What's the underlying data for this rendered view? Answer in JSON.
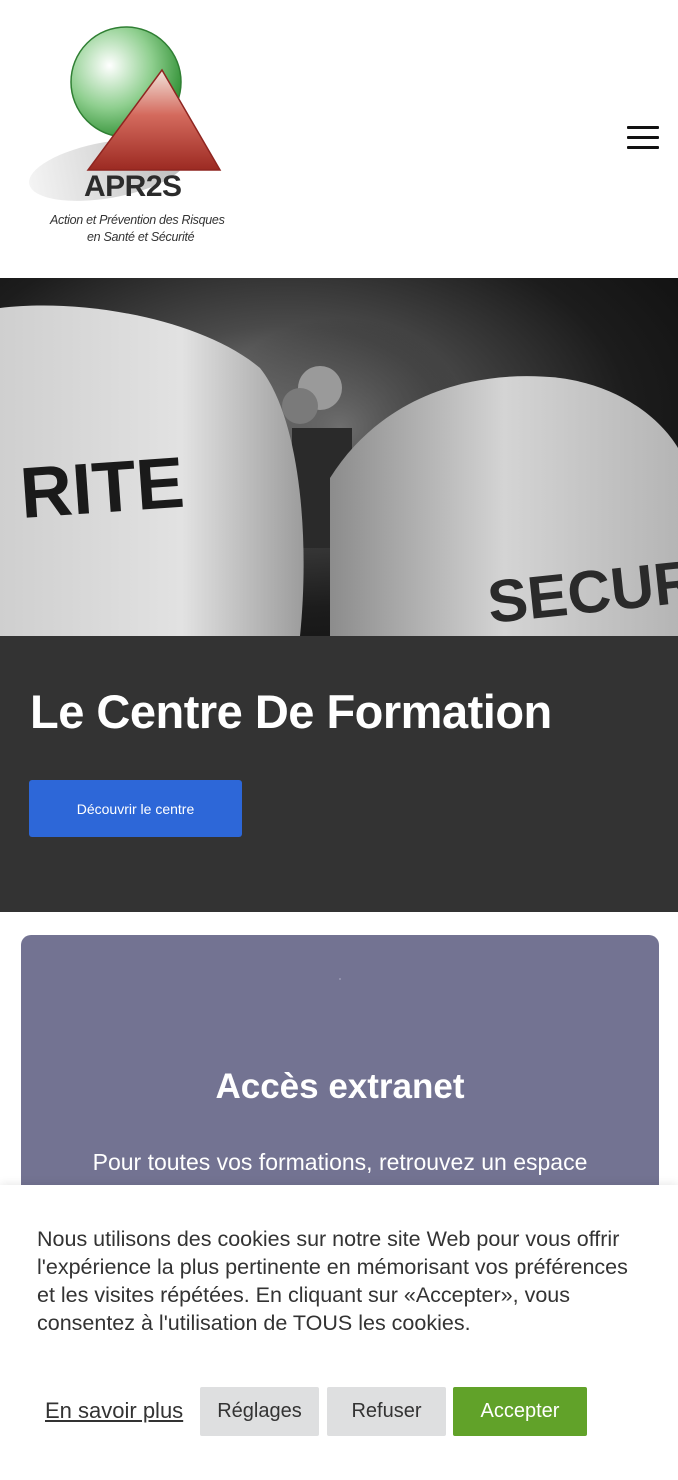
{
  "header": {
    "logo": {
      "name": "APR2S",
      "tagline_line1": "Action et Prévention des Risques",
      "tagline_line2": "en Santé et Sécurité",
      "colors": {
        "circle": "#3d9a3d",
        "triangle": "#b7302a"
      }
    },
    "menu_icon": "hamburger-menu-icon"
  },
  "hero": {
    "image": "security-staff-photo",
    "image_texts": {
      "left": "RITE",
      "right": "SECURIT"
    }
  },
  "formation": {
    "title": "Le Centre De Formation",
    "button_label": "Découvrir le centre",
    "background": "#333333",
    "button_color": "#2d67d8"
  },
  "extranet": {
    "title": "Accès extranet",
    "text": "Pour toutes vos formations, retrouvez un espace",
    "background": "#737392"
  },
  "cookie_banner": {
    "text": "Nous utilisons des cookies sur notre site Web pour vous offrir l'expérience la plus pertinente en mémorisant vos préférences et les visites répétées. En cliquant sur «Accepter», vous consentez à l'utilisation de TOUS les cookies.",
    "learn_more": "En savoir plus",
    "settings": "Réglages",
    "refuse": "Refuser",
    "accept": "Accepter",
    "accept_color": "#61a229"
  }
}
